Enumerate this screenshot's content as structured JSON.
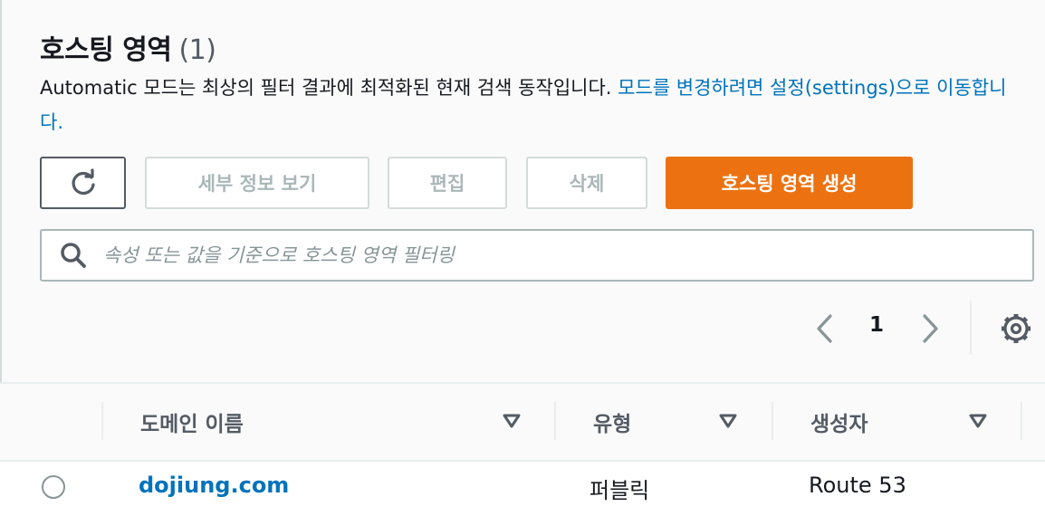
{
  "header": {
    "title": "호스팅 영역",
    "count": "(1)",
    "description_text": "Automatic 모드는 최상의 필터 결과에 최적화된 현재 검색 동작입니다. ",
    "description_link": "모드를 변경하려면 설정(settings)으로 이동합니다."
  },
  "actions": {
    "details_label": "세부 정보 보기",
    "edit_label": "편집",
    "delete_label": "삭제",
    "create_label": "호스팅 영역 생성"
  },
  "search": {
    "placeholder": "속성 또는 값을 기준으로 호스팅 영역 필터링",
    "value": ""
  },
  "pagination": {
    "current_page": "1"
  },
  "table": {
    "columns": [
      "도메인 이름",
      "유형",
      "생성자"
    ],
    "rows": [
      {
        "domain": "dojiung.com",
        "type": "퍼블릭",
        "created_by": "Route 53"
      }
    ]
  },
  "colors": {
    "primary": "#ec7211",
    "link": "#0073bb",
    "disabled_text": "#aab7b8",
    "border": "#d5dbdb"
  },
  "icons": [
    "refresh-icon",
    "search-icon",
    "chevron-left-icon",
    "chevron-right-icon",
    "gear-icon",
    "sort-icon"
  ]
}
